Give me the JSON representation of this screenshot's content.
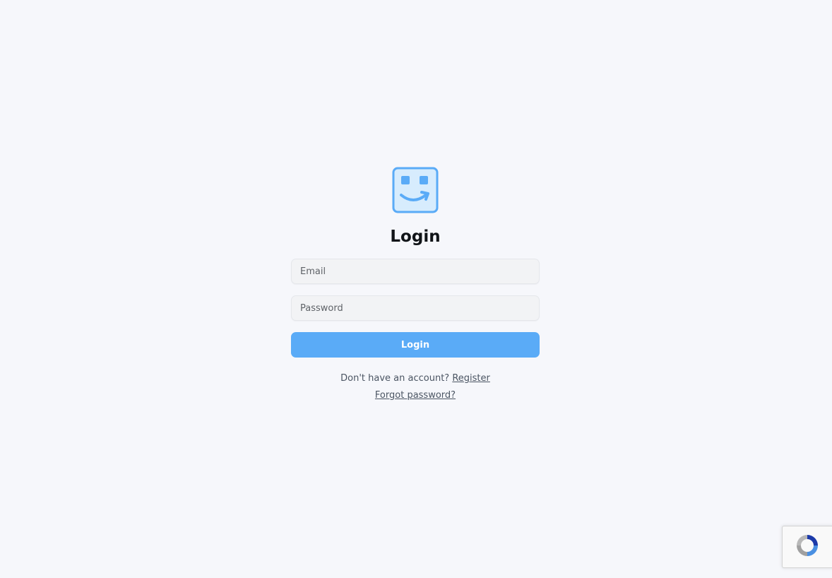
{
  "app": {
    "logo_icon": "smiley-box-icon",
    "accent_color": "#5aabf7"
  },
  "login": {
    "title": "Login",
    "email_placeholder": "Email",
    "password_placeholder": "Password",
    "submit_label": "Login"
  },
  "footer_links": {
    "register_prompt": "Don't have an account?",
    "register_label": "Register",
    "forgot_label": "Forgot password?"
  },
  "recaptcha": {
    "icon": "recaptcha-icon"
  }
}
